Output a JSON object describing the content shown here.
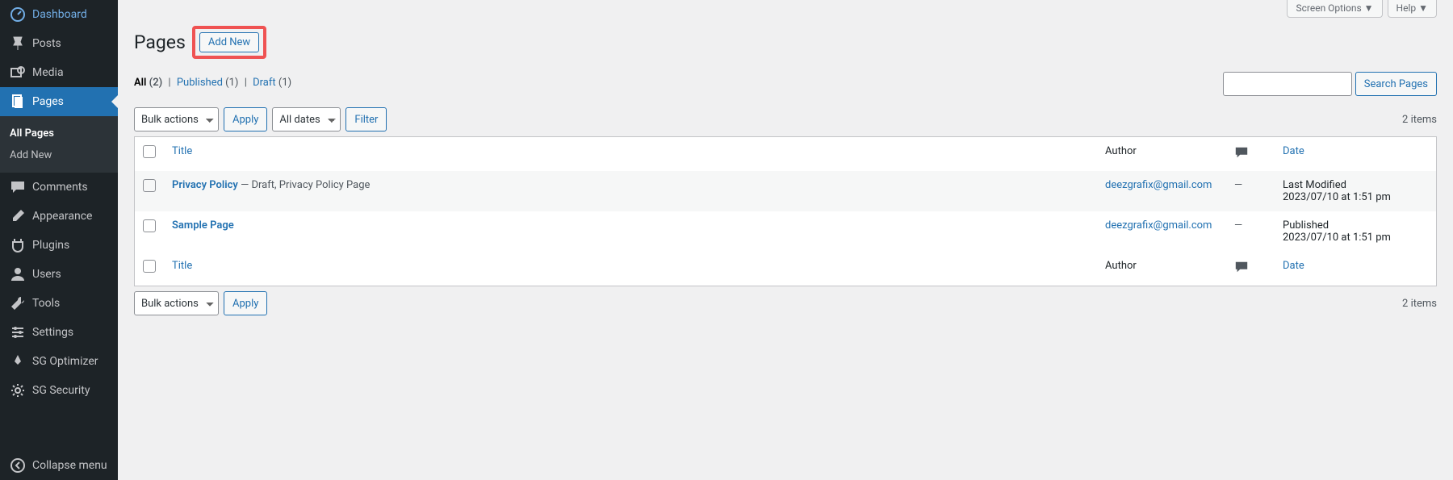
{
  "sidebar": {
    "items": [
      {
        "label": "Dashboard"
      },
      {
        "label": "Posts"
      },
      {
        "label": "Media"
      },
      {
        "label": "Pages"
      },
      {
        "label": "Comments"
      },
      {
        "label": "Appearance"
      },
      {
        "label": "Plugins"
      },
      {
        "label": "Users"
      },
      {
        "label": "Tools"
      },
      {
        "label": "Settings"
      },
      {
        "label": "SG Optimizer"
      },
      {
        "label": "SG Security"
      }
    ],
    "sub": {
      "all": "All Pages",
      "add": "Add New"
    },
    "collapse": "Collapse menu"
  },
  "topbar": {
    "screen": "Screen Options",
    "help": "Help"
  },
  "header": {
    "title": "Pages",
    "add_new": "Add New"
  },
  "filters": {
    "all": "All",
    "all_count": "(2)",
    "published": "Published",
    "published_count": "(1)",
    "draft": "Draft",
    "draft_count": "(1)"
  },
  "search": {
    "btn": "Search Pages"
  },
  "actions": {
    "bulk": "Bulk actions",
    "apply": "Apply",
    "all_dates": "All dates",
    "filter": "Filter"
  },
  "count_text": "2 items",
  "columns": {
    "title": "Title",
    "author": "Author",
    "date": "Date"
  },
  "rows": [
    {
      "title": "Privacy Policy",
      "meta": " — Draft, Privacy Policy Page",
      "author": "deezgrafix@gmail.com",
      "comments": "—",
      "date_status": "Last Modified",
      "date_time": "2023/07/10 at 1:51 pm"
    },
    {
      "title": "Sample Page",
      "meta": "",
      "author": "deezgrafix@gmail.com",
      "comments": "—",
      "date_status": "Published",
      "date_time": "2023/07/10 at 1:51 pm"
    }
  ]
}
